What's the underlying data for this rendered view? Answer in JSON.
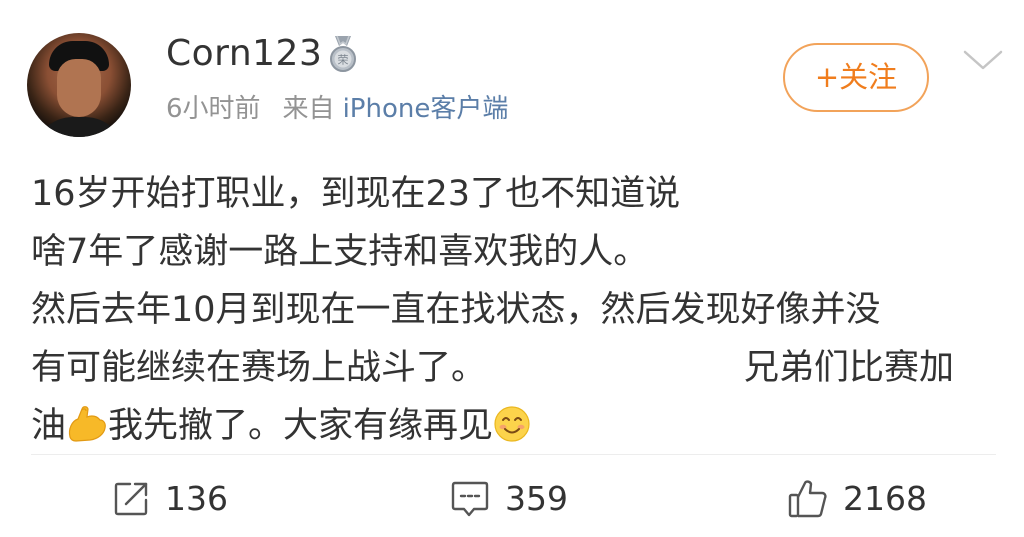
{
  "user": {
    "name": "Corn123",
    "avatar_icon": "user-avatar",
    "badge_icon": "medal-badge-icon"
  },
  "meta": {
    "time": "6小时前",
    "from_label": "来自",
    "source": "iPhone客户端"
  },
  "follow_button": {
    "label": "+关注",
    "color": "#f07d1d"
  },
  "post": {
    "lines": [
      "16岁开始打职业，到现在23了也不知道说",
      "啥7年了感谢一路上支持和喜欢我的人。",
      "然后去年10月到现在一直在找状态，然后发现好像并没",
      "有可能继续在赛场上战斗了。",
      "兄弟们比赛加",
      "油",
      "我先撤了。大家有缘再见"
    ]
  },
  "actions": {
    "repost_count": "136",
    "comment_count": "359",
    "like_count": "2168"
  },
  "colors": {
    "text": "#333333",
    "meta": "#939393",
    "link": "#5b7ea8",
    "accent": "#f07d1d"
  }
}
